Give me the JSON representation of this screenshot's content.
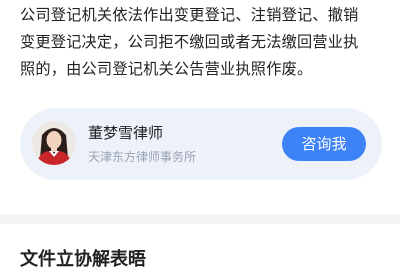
{
  "article": {
    "lines": [
      "公司登记机关依法作出变更登记、注销登记、撤销",
      "变更登记决定，公司拒不缴回或者无法缴回营业执",
      "照的，由公司登记机关公告营业执照作废。"
    ]
  },
  "lawyer_card": {
    "name": "董梦雪律师",
    "firm": "天津东方律师事务所",
    "consult_label": "咨询我",
    "accent_color": "#3d82f7",
    "card_bg": "#edf1f9",
    "avatar_icon": "lawyer-portrait"
  },
  "next_section": {
    "heading": "文件立协解表晤"
  }
}
